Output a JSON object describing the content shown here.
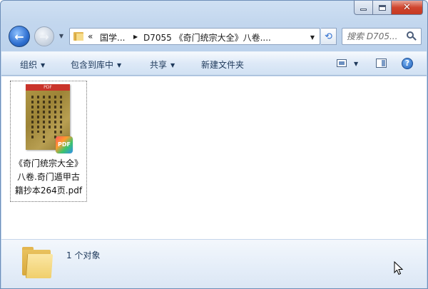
{
  "window": {
    "caption_buttons": [
      "minimize",
      "maximize",
      "close"
    ],
    "close_glyph": "✕"
  },
  "nav": {
    "back_glyph": "←",
    "forward_glyph": "→",
    "recent_glyph": "▼"
  },
  "address": {
    "chevron": "«",
    "segments": [
      "国学...",
      "D7055 《奇门统宗大全》八卷...."
    ],
    "separator_glyph": "▶",
    "dropdown_glyph": "▼",
    "refresh_glyph": "⟲"
  },
  "search": {
    "placeholder": "搜索 D705..."
  },
  "toolbar": {
    "organize": "组织",
    "include_in_library": "包含到库中",
    "share": "共享",
    "new_folder": "新建文件夹",
    "help_glyph": "?",
    "dropdown_glyph": "▼"
  },
  "files": [
    {
      "name_line1": "《奇门统宗大全》",
      "name_line2": "八卷.奇门遁甲古",
      "name_line3": "籍抄本264页.pdf",
      "thumb_header": "PDF",
      "badge": "PDF",
      "icon": "pdf-file-icon"
    }
  ],
  "status": {
    "count_text": "1 个对象"
  }
}
